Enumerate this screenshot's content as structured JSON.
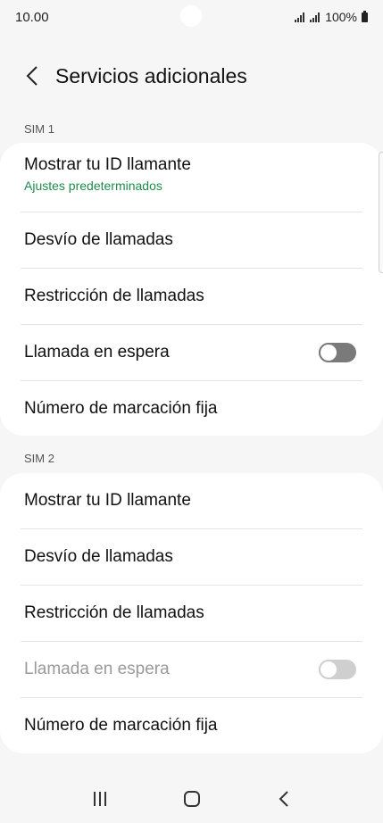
{
  "status_bar": {
    "time": "10.00",
    "battery": "100%"
  },
  "header": {
    "title": "Servicios adicionales"
  },
  "sim1": {
    "label": "SIM 1",
    "caller_id": "Mostrar tu ID llamante",
    "caller_id_sub": "Ajustes predeterminados",
    "forwarding": "Desvío de llamadas",
    "barring": "Restricción de llamadas",
    "waiting": "Llamada en espera",
    "fdn": "Número de marcación fija"
  },
  "sim2": {
    "label": "SIM 2",
    "caller_id": "Mostrar tu ID llamante",
    "forwarding": "Desvío de llamadas",
    "barring": "Restricción de llamadas",
    "waiting": "Llamada en espera",
    "fdn": "Número de marcación fija"
  },
  "colors": {
    "accent_green": "#1f8a4c",
    "background": "#f6f6f6",
    "card": "#ffffff"
  },
  "icons": {
    "back": "chevron-left-icon",
    "recents": "recents-icon",
    "home": "home-icon",
    "nav_back": "nav-back-icon"
  }
}
